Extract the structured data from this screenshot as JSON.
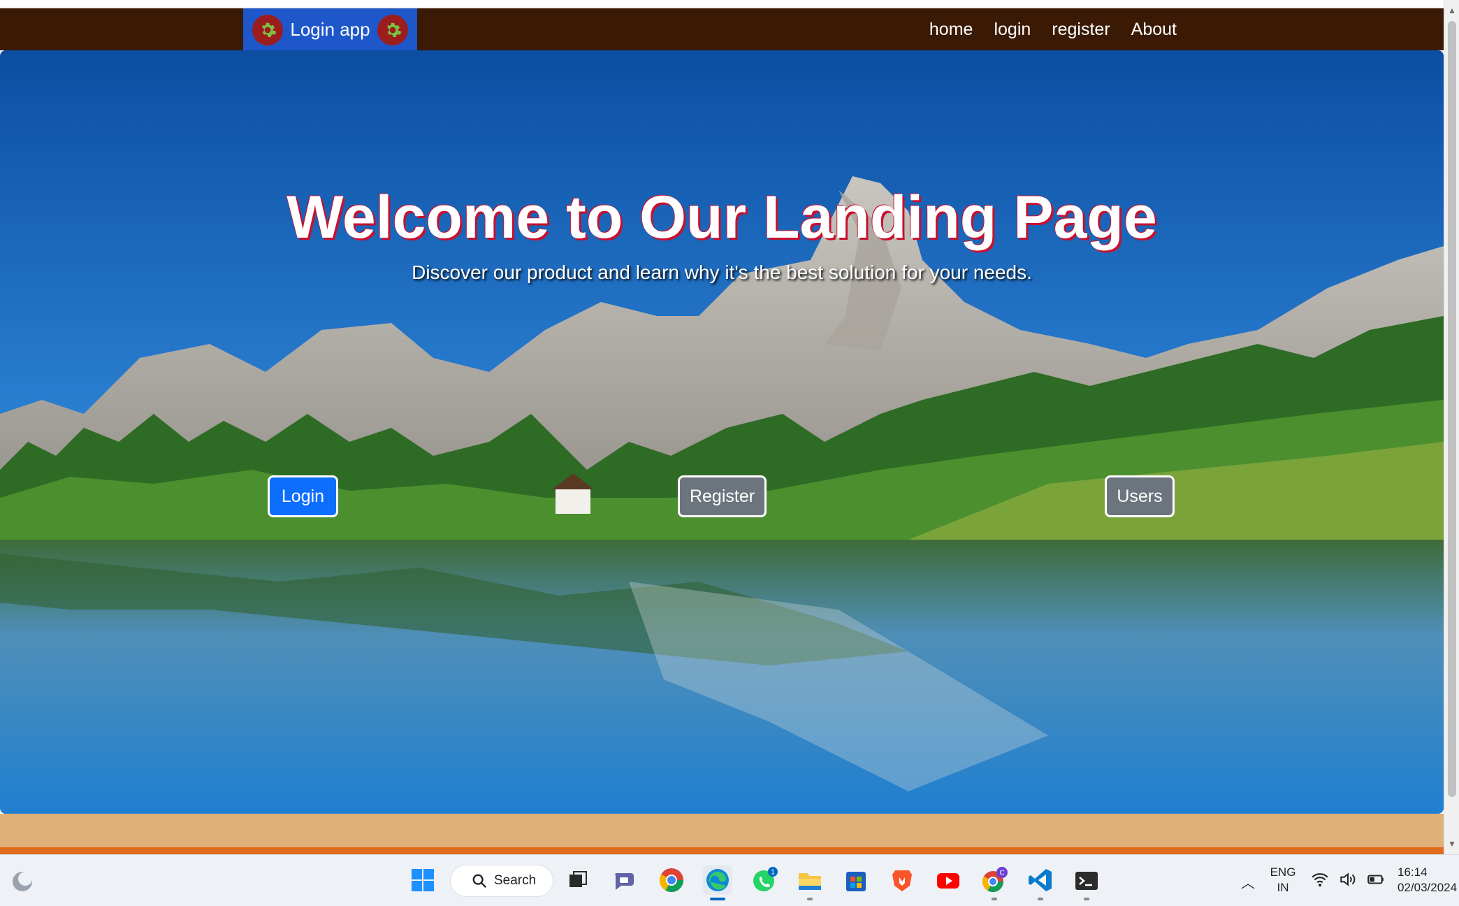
{
  "navbar": {
    "brand": "Login app",
    "links": [
      "home",
      "login",
      "register",
      "About"
    ],
    "background": "#3a1a05",
    "brand_background": "#1e57c9"
  },
  "hero": {
    "title": "Welcome to Our Landing Page",
    "subtitle": "Discover our product and learn why it's the best solution for your needs.",
    "buttons": {
      "login": "Login",
      "register": "Register",
      "users": "Users"
    },
    "title_shadow_color": "#c8102e",
    "primary_color": "#0d6efd",
    "secondary_color": "#6c757d"
  },
  "footer": {
    "band_color": "#e0b07a",
    "line_color": "#e06b1a"
  },
  "taskbar": {
    "search_label": "Search",
    "whatsapp_badge": "1",
    "chrome_profile_badge": "C",
    "apps": [
      "windows-start",
      "search",
      "task-view",
      "teams",
      "chrome",
      "edge",
      "whatsapp",
      "file-explorer",
      "microsoft-store",
      "brave",
      "youtube",
      "chrome-profile",
      "vscode",
      "terminal"
    ],
    "tray": {
      "lang_line1": "ENG",
      "lang_line2": "IN",
      "time": "16:14",
      "date": "02/03/2024"
    }
  }
}
